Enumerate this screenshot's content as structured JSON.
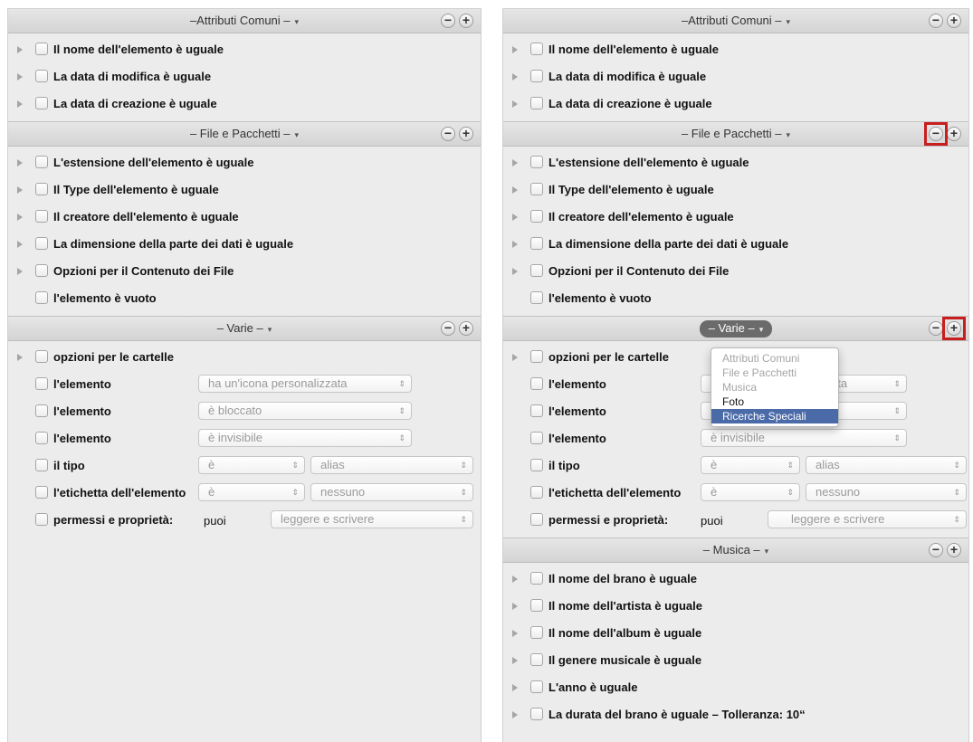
{
  "left": {
    "groups": [
      {
        "title": "–Attributi Comuni –",
        "rows": [
          {
            "label": "Il nome dell'elemento è uguale"
          },
          {
            "label": "La data di modifica è uguale"
          },
          {
            "label": "La data di creazione è uguale"
          }
        ]
      },
      {
        "title": "– File e Pacchetti –",
        "rows": [
          {
            "label": "L'estensione dell'elemento è uguale"
          },
          {
            "label": "Il Type dell'elemento è uguale"
          },
          {
            "label": "Il creatore dell'elemento è uguale"
          },
          {
            "label": "La dimensione della parte dei dati è uguale"
          },
          {
            "label": "Opzioni per il Contenuto dei File"
          },
          {
            "label": "l'elemento è vuoto"
          }
        ]
      },
      {
        "title": "– Varie –",
        "rows": [
          {
            "label": "opzioni per le cartelle"
          },
          {
            "label": "l'elemento",
            "select": "ha un'icona personalizzata"
          },
          {
            "label": "l'elemento",
            "select": "è bloccato"
          },
          {
            "label": "l'elemento",
            "select": "è invisibile"
          },
          {
            "label": "il tipo",
            "select": "è",
            "select2": "alias"
          },
          {
            "label": "l'etichetta dell'elemento",
            "select": "è",
            "select2": "nessuno"
          },
          {
            "label": "permessi e proprietà:",
            "text": "puoi",
            "select": "leggere e scrivere"
          }
        ]
      }
    ]
  },
  "right": {
    "groups": [
      {
        "title": "–Attributi Comuni –",
        "rows": [
          {
            "label": "Il nome dell'elemento è uguale"
          },
          {
            "label": "La data di modifica è uguale"
          },
          {
            "label": "La data di creazione è uguale"
          }
        ]
      },
      {
        "title": "– File e Pacchetti –",
        "rows": [
          {
            "label": "L'estensione dell'elemento è uguale"
          },
          {
            "label": "Il Type dell'elemento è uguale"
          },
          {
            "label": "Il creatore dell'elemento è uguale"
          },
          {
            "label": "La dimensione della parte dei dati è uguale"
          },
          {
            "label": "Opzioni per il Contenuto dei File"
          },
          {
            "label": "l'elemento è vuoto"
          }
        ]
      },
      {
        "title": "– Varie –",
        "rows": [
          {
            "label": "opzioni per le cartelle"
          },
          {
            "label": "l'elemento",
            "select": "zzata"
          },
          {
            "label": "l'elemento",
            "select": ""
          },
          {
            "label": "l'elemento",
            "select": "è invisibile"
          },
          {
            "label": "il tipo",
            "select": "è",
            "select2": "alias"
          },
          {
            "label": "l'etichetta dell'elemento",
            "select": "è",
            "select2": "nessuno"
          },
          {
            "label": "permessi e proprietà:",
            "text": "puoi",
            "select": "leggere e scrivere"
          }
        ]
      },
      {
        "title": "– Musica –",
        "rows": [
          {
            "label": "Il nome del brano è uguale"
          },
          {
            "label": "Il nome dell'artista è uguale"
          },
          {
            "label": "Il nome dell'album è uguale"
          },
          {
            "label": "Il genere musicale è uguale"
          },
          {
            "label": "L'anno è uguale"
          },
          {
            "label": "La durata del brano è uguale – Tolleranza: 10“"
          }
        ]
      }
    ],
    "menu": [
      {
        "label": "Attributi Comuni",
        "state": "disabled"
      },
      {
        "label": "File e Pacchetti",
        "state": "disabled"
      },
      {
        "label": "Musica",
        "state": "disabled"
      },
      {
        "label": "Foto",
        "state": "enabled"
      },
      {
        "label": "Ricerche Speciali",
        "state": "selected"
      }
    ]
  },
  "controls": {
    "minus": "−",
    "plus": "+",
    "caret": "▾",
    "select_arrows": "⌃⌄"
  },
  "colors": {
    "highlight": "#c81e1e",
    "menu_selected": "#4a6aa8",
    "active_header_pill": "#6b6b6b"
  }
}
